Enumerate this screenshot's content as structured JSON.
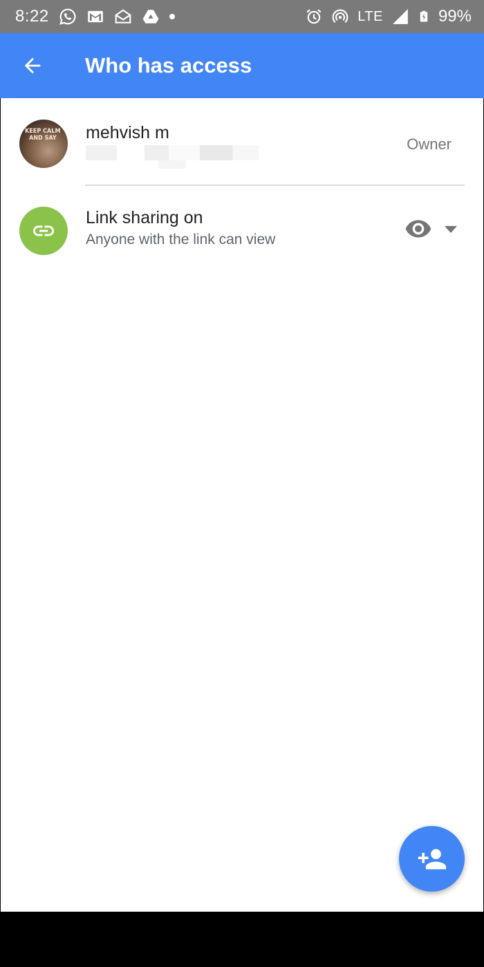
{
  "status_bar": {
    "time": "8:22",
    "network": "LTE",
    "battery": "99%",
    "icons": [
      "whatsapp-icon",
      "gmail-icon",
      "mail-open-icon",
      "drive-icon",
      "dot-icon",
      "alarm-icon",
      "hotspot-icon",
      "signal-icon",
      "battery-charging-icon"
    ]
  },
  "app_bar": {
    "title": "Who has access",
    "back_icon": "arrow-back-icon",
    "color": "#4285f4"
  },
  "owner": {
    "name": "mehvish m",
    "role": "Owner",
    "avatar_text_1": "KEEP CALM",
    "avatar_text_2": "AND SAY"
  },
  "link_sharing": {
    "title": "Link sharing on",
    "subtitle": "Anyone with the link can view",
    "icon": "link-icon",
    "permission_icon": "eye-icon",
    "circle_color": "#8bc34a"
  },
  "fab": {
    "icon": "person-add-icon",
    "color": "#4285f4"
  }
}
